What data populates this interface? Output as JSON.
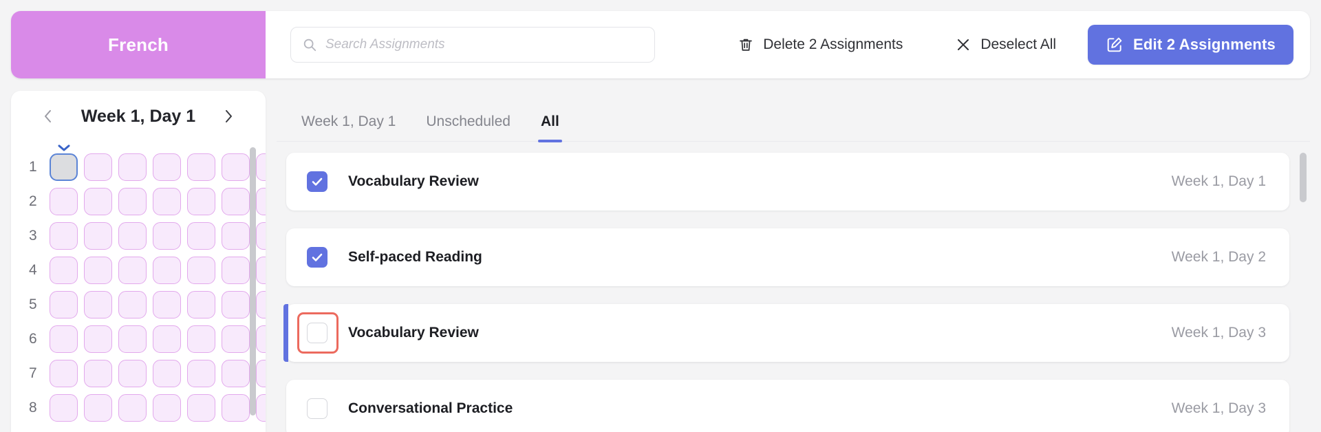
{
  "topbar": {
    "subject": "French",
    "search": {
      "placeholder": "Search Assignments",
      "value": ""
    },
    "delete_label": "Delete 2 Assignments",
    "deselect_label": "Deselect All",
    "edit_label": "Edit 2 Assignments",
    "icons": {
      "search": "search-icon",
      "trash": "trash-icon",
      "close": "close-icon",
      "edit": "edit-square-icon"
    },
    "colors": {
      "subject_tile": "#d98ae8",
      "primary": "#6172e0"
    }
  },
  "sidebar": {
    "week_title": "Week 1, Day 1",
    "prev_label": "‹",
    "next_label": "›",
    "rows": [
      {
        "number": "1",
        "cells": 7,
        "selected_index": 0
      },
      {
        "number": "2",
        "cells": 7,
        "selected_index": -1
      },
      {
        "number": "3",
        "cells": 7,
        "selected_index": -1
      },
      {
        "number": "4",
        "cells": 7,
        "selected_index": -1
      },
      {
        "number": "5",
        "cells": 7,
        "selected_index": -1
      },
      {
        "number": "6",
        "cells": 7,
        "selected_index": -1
      },
      {
        "number": "7",
        "cells": 7,
        "selected_index": -1
      },
      {
        "number": "8",
        "cells": 7,
        "selected_index": -1
      }
    ],
    "colors": {
      "cell_fill": "#f8eafc",
      "cell_border": "#e2a8ec",
      "selected_border": "#5b84d6",
      "selected_fill": "#dcdde0"
    }
  },
  "main": {
    "tabs": [
      {
        "label": "Week 1, Day 1",
        "active": false
      },
      {
        "label": "Unscheduled",
        "active": false
      },
      {
        "label": "All",
        "active": true
      }
    ],
    "assignments": [
      {
        "title": "Vocabulary Review",
        "day": "Week 1, Day 1",
        "checked": true,
        "focused": false,
        "annotated": false
      },
      {
        "title": "Self-paced Reading",
        "day": "Week 1, Day 2",
        "checked": true,
        "focused": false,
        "annotated": false
      },
      {
        "title": "Vocabulary Review",
        "day": "Week 1, Day 3",
        "checked": false,
        "focused": true,
        "annotated": true
      },
      {
        "title": "Conversational Practice",
        "day": "Week 1, Day 3",
        "checked": false,
        "focused": false,
        "annotated": false
      }
    ],
    "annotation_color": "#ec6a5e"
  }
}
